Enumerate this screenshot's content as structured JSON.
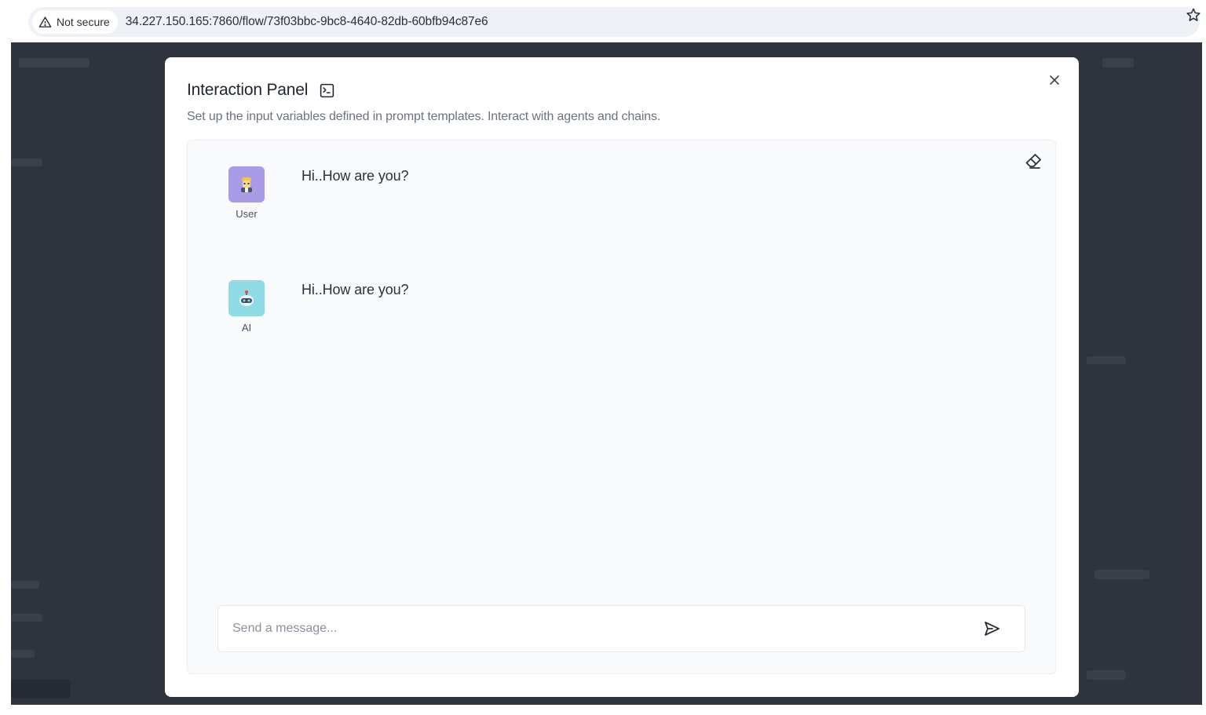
{
  "browser": {
    "security_label": "Not secure",
    "url": "34.227.150.165:7860/flow/73f03bbc-9bc8-4640-82db-60bfb94c87e6"
  },
  "modal": {
    "title": "Interaction Panel",
    "subtitle": "Set up the input variables defined in prompt templates. Interact with agents and chains."
  },
  "chat": {
    "messages": [
      {
        "sender": "User",
        "text": "Hi..How are you?",
        "avatar_icon": "user-avatar-icon",
        "avatar_color": "#a99be8"
      },
      {
        "sender": "AI",
        "text": "Hi..How are you?",
        "avatar_icon": "ai-avatar-icon",
        "avatar_color": "#8fdbe6"
      }
    ],
    "input": {
      "placeholder": "Send a message...",
      "value": ""
    }
  },
  "icons": {
    "security": "warning-triangle-icon",
    "bookmark": "star-icon",
    "title": "terminal-icon",
    "close": "close-icon",
    "clear": "eraser-icon",
    "send": "send-icon"
  }
}
